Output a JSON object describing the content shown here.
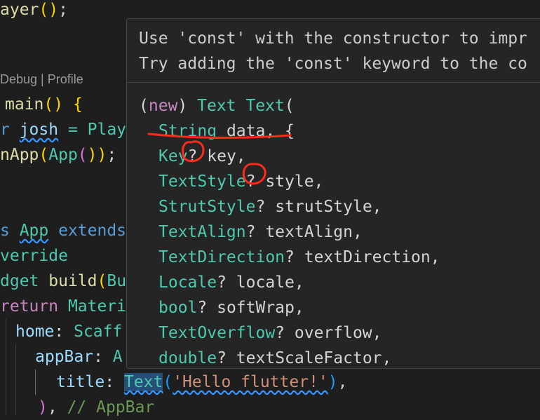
{
  "editor": {
    "codelens": "Debug | Profile",
    "lines": {
      "l1": [
        "ayer",
        "(",
        ")",
        ";"
      ],
      "l5": [
        "main",
        "(",
        ")",
        " {"
      ],
      "l6": [
        "r ",
        "josh",
        " = Play"
      ],
      "l7": [
        "nApp",
        "(",
        "App",
        "(",
        "))",
        ";"
      ],
      "l9": [
        "s ",
        "App",
        " extends"
      ],
      "l10": "verride",
      "l11": [
        "dget ",
        "build",
        "(",
        "Bu"
      ],
      "l12": [
        "return ",
        "Materi"
      ],
      "l13": [
        "home",
        ": ",
        "Scaff"
      ],
      "l14": [
        "appBar",
        ": ",
        "A"
      ],
      "l15": [
        "title",
        ": ",
        "Text",
        "(",
        "'Hello flutter!'",
        ")",
        ","
      ],
      "l16": [
        ")",
        ", ",
        "// AppBar"
      ]
    }
  },
  "hover": {
    "message_line1": "Use 'const' with the constructor to impr",
    "message_line2": "Try adding the 'const' keyword to the co",
    "signature": {
      "header": [
        "(",
        "new",
        ") ",
        "Text",
        " ",
        "Text",
        "("
      ],
      "params": [
        {
          "type": "String",
          "q": "",
          "name": " data, {"
        },
        {
          "type": "Key",
          "q": "?",
          "name": " key,"
        },
        {
          "type": "TextStyle",
          "q": "?",
          "name": " style,"
        },
        {
          "type": "StrutStyle",
          "q": "?",
          "name": " strutStyle,"
        },
        {
          "type": "TextAlign",
          "q": "?",
          "name": " textAlign,"
        },
        {
          "type": "TextDirection",
          "q": "?",
          "name": " textDirection,"
        },
        {
          "type": "Locale",
          "q": "?",
          "name": " locale,"
        },
        {
          "type": "bool",
          "q": "?",
          "name": " softWrap,"
        },
        {
          "type": "TextOverflow",
          "q": "?",
          "name": " overflow,"
        },
        {
          "type": "double",
          "q": "?",
          "name": " textScaleFactor,"
        }
      ]
    }
  },
  "annotation_color": "#ff2a1a"
}
